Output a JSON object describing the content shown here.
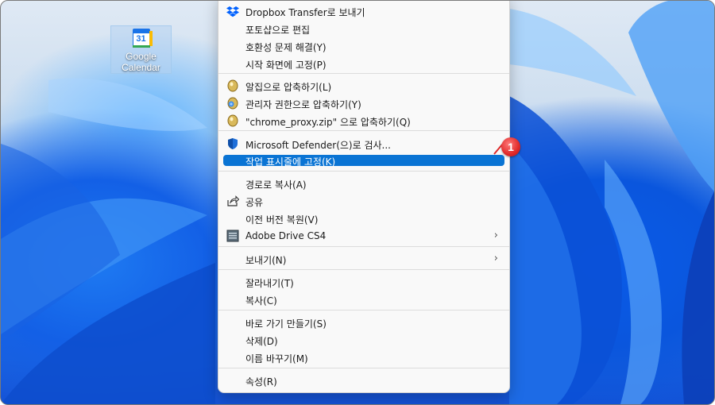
{
  "desktop": {
    "icon_label_line1": "Google",
    "icon_label_line2": "Calendar",
    "icon_day": "31"
  },
  "menu": {
    "items": [
      {
        "label": "Dropbox Transfer로 보내기",
        "icon": "dropbox-icon"
      },
      {
        "label": "포토샵으로 편집",
        "icon": ""
      },
      {
        "label": "호환성 문제 해결(Y)",
        "icon": ""
      },
      {
        "label": "시작 화면에 고정(P)",
        "icon": ""
      },
      {
        "label": "알집으로 압축하기(L)",
        "icon": "alzip-icon"
      },
      {
        "label": "관리자 권한으로 압축하기(Y)",
        "icon": "alzip-admin-icon"
      },
      {
        "label": "\"chrome_proxy.zip\" 으로 압축하기(Q)",
        "icon": "alzip-icon"
      },
      {
        "label": "Microsoft Defender(으)로 검사...",
        "icon": "defender-shield-icon"
      },
      {
        "label": "작업 표시줄에 고정(K)",
        "icon": ""
      },
      {
        "label": "경로로 복사(A)",
        "icon": ""
      },
      {
        "label": "공유",
        "icon": "share-icon"
      },
      {
        "label": "이전 버전 복원(V)",
        "icon": ""
      },
      {
        "label": "Adobe Drive CS4",
        "icon": "adobe-drive-icon"
      },
      {
        "label": "보내기(N)",
        "icon": ""
      },
      {
        "label": "잘라내기(T)",
        "icon": ""
      },
      {
        "label": "복사(C)",
        "icon": ""
      },
      {
        "label": "바로 가기 만들기(S)",
        "icon": ""
      },
      {
        "label": "삭제(D)",
        "icon": ""
      },
      {
        "label": "이름 바꾸기(M)",
        "icon": ""
      },
      {
        "label": "속성(R)",
        "icon": ""
      }
    ]
  },
  "annotation": {
    "step_number": "1",
    "color": "#e02a2a"
  },
  "colors": {
    "highlight": "#0a74d4",
    "menu_bg": "#f9f9f9"
  }
}
